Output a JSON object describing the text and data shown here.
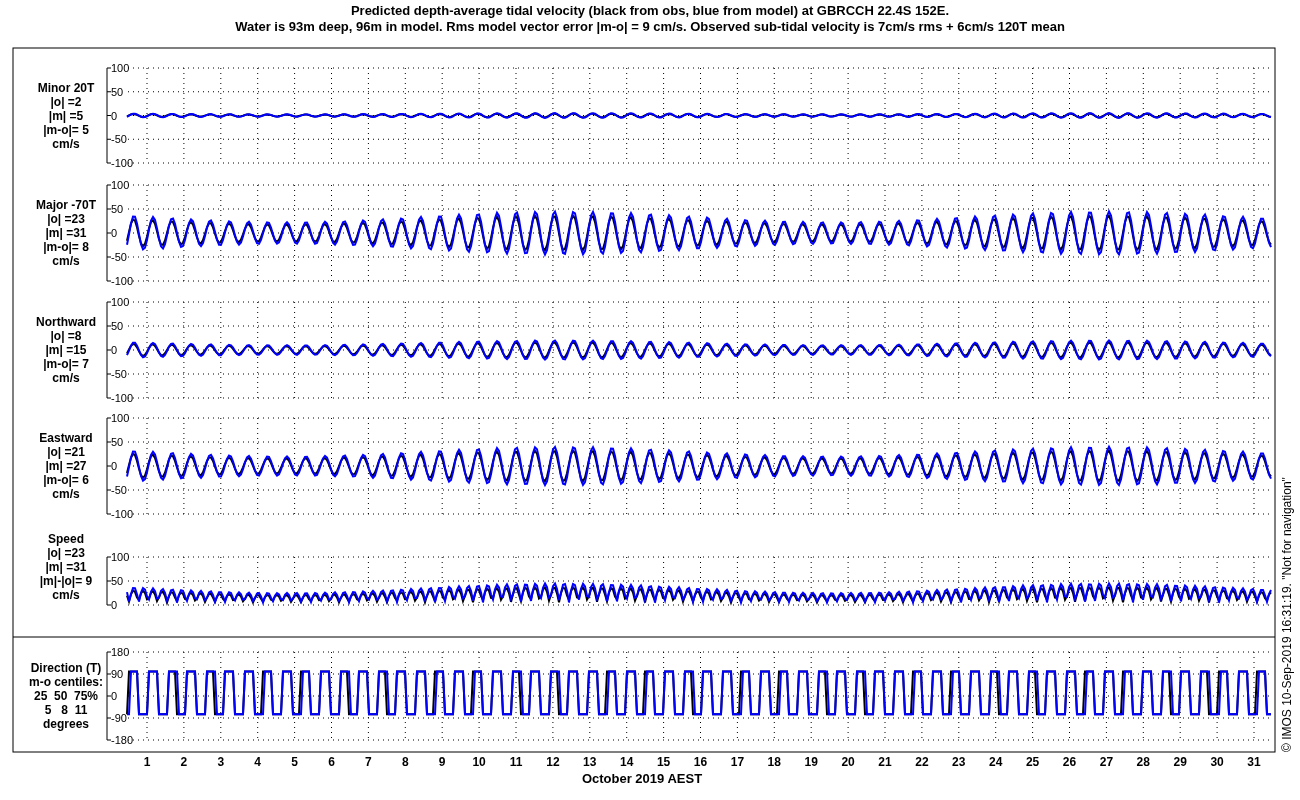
{
  "title": [
    "Predicted depth-average tidal velocity (black from obs, blue from model) at GBRCCH 22.4S 152E.",
    "Water is 93m deep, 96m in model. Rms model vector error |m-o| = 9 cm/s. Observed sub-tidal velocity is 7cm/s rms + 6cm/s 120T mean"
  ],
  "panels": [
    {
      "kind": "signed",
      "label_lines": [
        "Minor 20T",
        "|o| =2",
        "|m| =5",
        "|m-o|= 5",
        "cm/s"
      ],
      "yticks": [
        "100",
        "50",
        "0",
        "-50",
        "-100"
      ]
    },
    {
      "kind": "signed",
      "label_lines": [
        "Major -70T",
        "|o| =23",
        "|m| =31",
        "|m-o|= 8",
        "cm/s"
      ],
      "yticks": [
        "100",
        "50",
        "0",
        "-50",
        "-100"
      ]
    },
    {
      "kind": "signed",
      "label_lines": [
        "Northward",
        "|o| =8",
        "|m| =15",
        "|m-o|= 7",
        "cm/s"
      ],
      "yticks": [
        "100",
        "50",
        "0",
        "-50",
        "-100"
      ]
    },
    {
      "kind": "signed",
      "label_lines": [
        "Eastward",
        "|o| =21",
        "|m| =27",
        "|m-o|= 6",
        "cm/s"
      ],
      "yticks": [
        "100",
        "50",
        "0",
        "-50",
        "-100"
      ]
    },
    {
      "kind": "speed",
      "label_lines": [
        "Speed",
        "|o| =23",
        "|m| =31",
        "|m|-|o|= 9",
        "cm/s"
      ],
      "yticks": [
        "100",
        "50",
        "0"
      ]
    },
    {
      "kind": "direction",
      "label_lines": [
        "Direction (T)",
        "m-o centiles:",
        "25  50  75%",
        "5   8  11",
        "degrees"
      ],
      "yticks": [
        "180",
        "90",
        "0",
        "-90",
        "-180"
      ]
    }
  ],
  "xticks": [
    "1",
    "2",
    "3",
    "4",
    "5",
    "6",
    "7",
    "8",
    "9",
    "10",
    "11",
    "12",
    "13",
    "14",
    "15",
    "16",
    "17",
    "18",
    "19",
    "20",
    "21",
    "22",
    "23",
    "24",
    "25",
    "26",
    "27",
    "28",
    "29",
    "30",
    "31"
  ],
  "xlabel": "October 2019 AEST",
  "credit": "© IMOS 10-Sep-2019 16:31:19. \"Not for navigation\""
}
